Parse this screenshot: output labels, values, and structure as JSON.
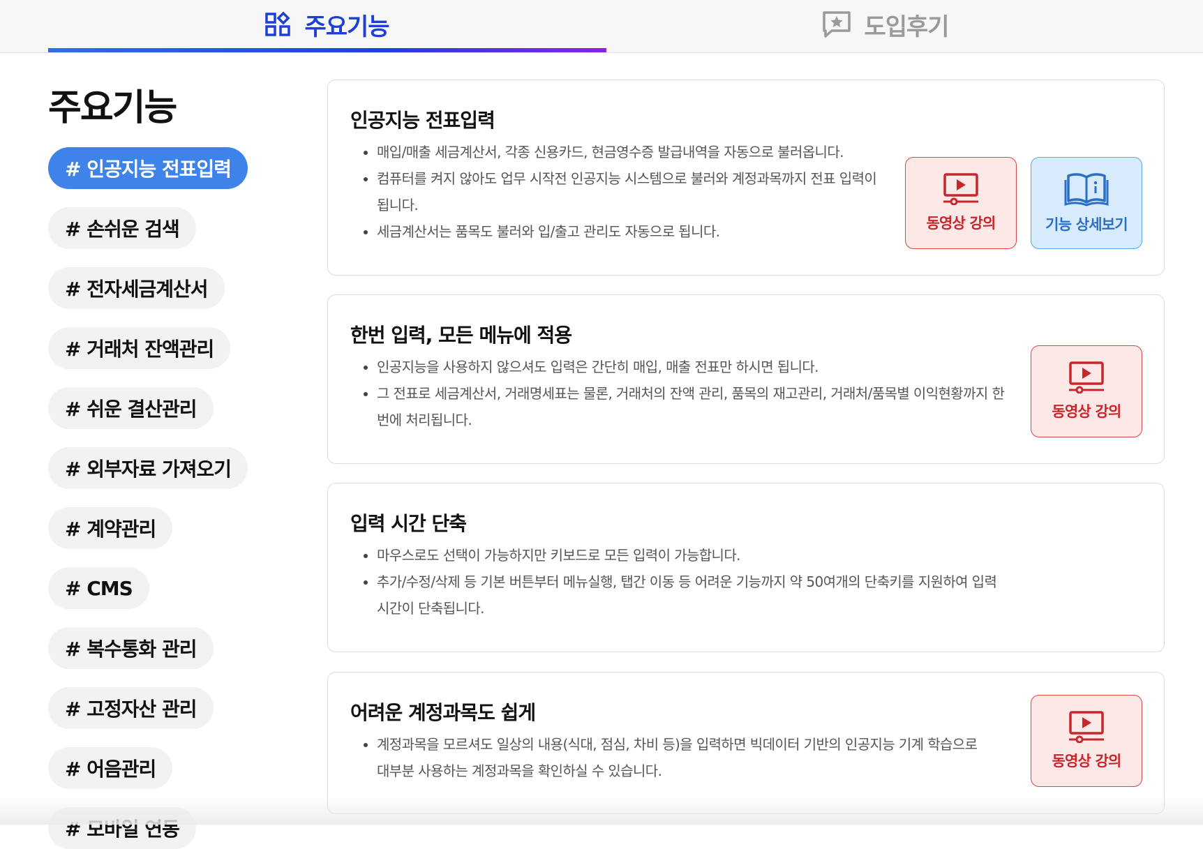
{
  "tabs": [
    {
      "label": "주요기능",
      "icon": "grid-icon",
      "active": true
    },
    {
      "label": "도입후기",
      "icon": "star-comment-icon",
      "active": false
    }
  ],
  "sidebar": {
    "title": "주요기능",
    "items": [
      {
        "label": "# 인공지능 전표입력",
        "active": true
      },
      {
        "label": "# 손쉬운 검색"
      },
      {
        "label": "# 전자세금계산서"
      },
      {
        "label": "# 거래처 잔액관리"
      },
      {
        "label": "# 쉬운 결산관리"
      },
      {
        "label": "# 외부자료 가져오기"
      },
      {
        "label": "# 계약관리"
      },
      {
        "label": "# CMS"
      },
      {
        "label": "# 복수통화 관리"
      },
      {
        "label": "# 고정자산 관리"
      },
      {
        "label": "# 어음관리"
      },
      {
        "label": "# 모바일 연동"
      }
    ]
  },
  "cards": [
    {
      "title": "인공지능 전표입력",
      "bullets": [
        "매입/매출 세금계산서, 각종 신용카드, 현금영수증 발급내역을 자동으로 불러옵니다.",
        "컴퓨터를 켜지 않아도 업무 시작전 인공지능 시스템으로 불러와 계정과목까지 전표 입력이 됩니다.",
        "세금계산서는 품목도 불러와 입/출고 관리도 자동으로 됩니다."
      ],
      "buttons": [
        "동영상 강의",
        "기능 상세보기"
      ]
    },
    {
      "title": "한번 입력, 모든 메뉴에 적용",
      "bullets": [
        "인공지능을 사용하지 않으셔도 입력은 간단히 매입, 매출 전표만 하시면 됩니다.",
        "그 전표로 세금계산서, 거래명세표는 물론, 거래처의 잔액 관리, 품목의 재고관리, 거래처/품목별 이익현황까지 한번에 처리됩니다."
      ],
      "buttons": [
        "동영상 강의"
      ]
    },
    {
      "title": "입력 시간 단축",
      "bullets": [
        "마우스로도 선택이 가능하지만 키보드로 모든 입력이 가능합니다.",
        "추가/수정/삭제 등 기본 버튼부터 메뉴실행, 탭간 이동 등 어려운 기능까지 약 50여개의 단축키를 지원하여 입력 시간이 단축됩니다."
      ],
      "buttons": []
    },
    {
      "title": "어려운 계정과목도 쉽게",
      "bullets": [
        "계정과목을 모르셔도 일상의 내용(식대, 점심, 차비 등)을 입력하면 빅데이터 기반의 인공지능 기계 학습으로 대부분 사용하는 계정과목을 확인하실 수 있습니다."
      ],
      "buttons": [
        "동영상 강의"
      ]
    }
  ],
  "colors": {
    "accent": "#1e3fd6",
    "active_pill": "#3d83ea",
    "video_red": "#c8262a",
    "detail_blue": "#2a6fc4"
  }
}
